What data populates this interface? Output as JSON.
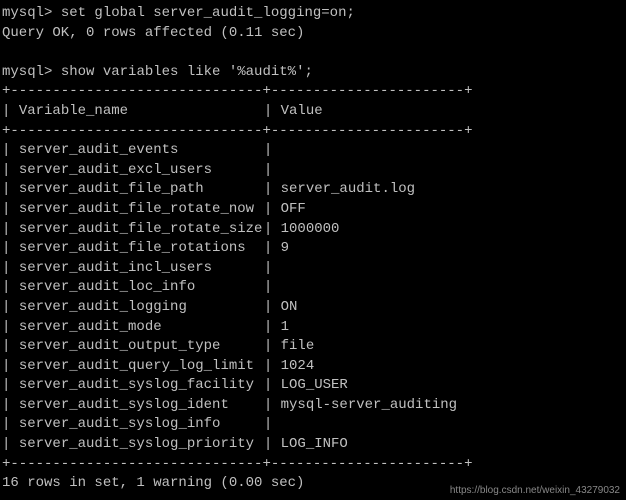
{
  "prompt": "mysql>",
  "command1": "set global server_audit_logging=on;",
  "result1": "Query OK, 0 rows affected (0.11 sec)",
  "command2": "show variables like '%audit%';",
  "table": {
    "header": {
      "col1": "Variable_name",
      "col2": "Value"
    },
    "border_top": "+------------------------------+-----------------------+",
    "border_mid": "+------------------------------+-----------------------+",
    "rows": [
      {
        "name": "server_audit_events",
        "value": ""
      },
      {
        "name": "server_audit_excl_users",
        "value": ""
      },
      {
        "name": "server_audit_file_path",
        "value": "server_audit.log"
      },
      {
        "name": "server_audit_file_rotate_now",
        "value": "OFF"
      },
      {
        "name": "server_audit_file_rotate_size",
        "value": "1000000"
      },
      {
        "name": "server_audit_file_rotations",
        "value": "9"
      },
      {
        "name": "server_audit_incl_users",
        "value": ""
      },
      {
        "name": "server_audit_loc_info",
        "value": ""
      },
      {
        "name": "server_audit_logging",
        "value": "ON"
      },
      {
        "name": "server_audit_mode",
        "value": "1"
      },
      {
        "name": "server_audit_output_type",
        "value": "file"
      },
      {
        "name": "server_audit_query_log_limit",
        "value": "1024"
      },
      {
        "name": "server_audit_syslog_facility",
        "value": "LOG_USER"
      },
      {
        "name": "server_audit_syslog_ident",
        "value": "mysql-server_auditing"
      },
      {
        "name": "server_audit_syslog_info",
        "value": ""
      },
      {
        "name": "server_audit_syslog_priority",
        "value": "LOG_INFO"
      }
    ]
  },
  "result2": "16 rows in set, 1 warning (0.00 sec)",
  "watermark": "https://blog.csdn.net/weixin_43279032"
}
